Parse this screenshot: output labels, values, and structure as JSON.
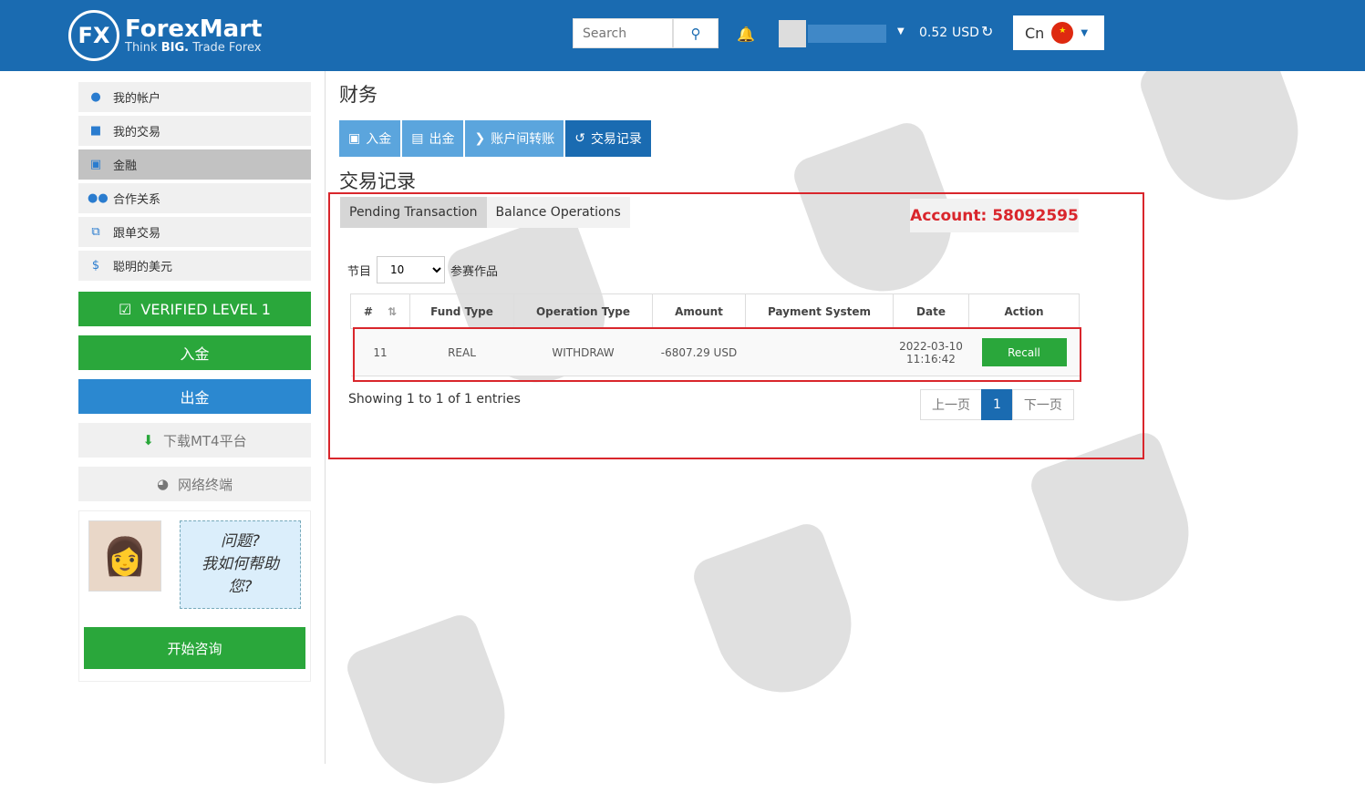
{
  "header": {
    "logo_mark": "FX",
    "logo_name": "ForexMart",
    "logo_tagline_1": "Think ",
    "logo_tagline_bold": "BIG.",
    "logo_tagline_2": " Trade Forex",
    "search_placeholder": "Search",
    "balance": "0.52",
    "currency": "USD",
    "lang": "Cn"
  },
  "sidebar": {
    "items": [
      {
        "label": "我的帐户",
        "icon": "user-icon"
      },
      {
        "label": "我的交易",
        "icon": "briefcase-icon"
      },
      {
        "label": "金融",
        "icon": "money-icon"
      },
      {
        "label": "合作关系",
        "icon": "users-icon"
      },
      {
        "label": "跟单交易",
        "icon": "copy-icon"
      },
      {
        "label": "聪明的美元",
        "icon": "dollar-icon"
      }
    ],
    "verified": "VERIFIED LEVEL 1",
    "deposit": "入金",
    "withdraw": "出金",
    "download": "下载MT4平台",
    "web": "网络终端",
    "help_text": [
      "问题?",
      "我如何帮助",
      "您?"
    ],
    "consult": "开始咨询"
  },
  "main": {
    "title": "财务",
    "tabs": [
      "入金",
      "出金",
      "账户间转账",
      "交易记录"
    ],
    "subtitle": "交易记录",
    "subtabs": [
      "Pending Transaction",
      "Balance Operations"
    ],
    "account": "Account: 58092595",
    "length_label": "节目",
    "length_value": "10",
    "length_suffix": "参赛作品",
    "columns": [
      "#",
      "Fund Type",
      "Operation Type",
      "Amount",
      "Payment System",
      "Date",
      "Action"
    ],
    "rows": [
      {
        "id": "11",
        "fund": "REAL",
        "op": "WITHDRAW",
        "amount": "-6807.29 USD",
        "payment": "",
        "date": "2022-03-10",
        "time": "11:16:42",
        "action": "Recall"
      }
    ],
    "info": "Showing 1 to 1 of 1 entries",
    "prev": "上一页",
    "page": "1",
    "next": "下一页"
  }
}
